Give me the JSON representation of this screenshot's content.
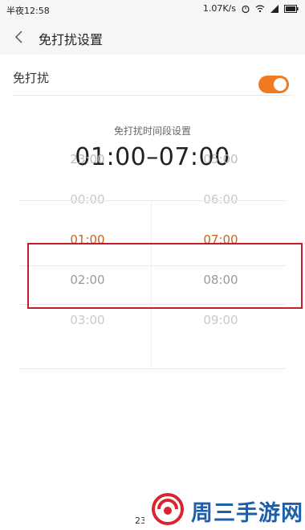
{
  "status_bar": {
    "time": "半夜12:58",
    "network_speed": "1.07K/s",
    "icons": [
      "alarm-icon",
      "wifi-icon",
      "signal-icon",
      "battery-icon"
    ]
  },
  "header": {
    "title": "免打扰设置",
    "back_icon": "chevron-left-icon"
  },
  "settings": {
    "dnd_label": "免打扰",
    "dnd_enabled": true,
    "toggle_color": "#f07a1f"
  },
  "period": {
    "label": "免打扰时间段设置",
    "value": "01:00–07:00"
  },
  "picker": {
    "start_items": [
      "23:00",
      "00:00",
      "01:00",
      "02:00",
      "03:00"
    ],
    "end_items": [
      "05:00",
      "06:00",
      "07:00",
      "08:00",
      "09:00"
    ],
    "selected_index": 2,
    "selected_color": "#c7651f"
  },
  "watermark": {
    "text": "周三手游网",
    "fragment": "23"
  }
}
